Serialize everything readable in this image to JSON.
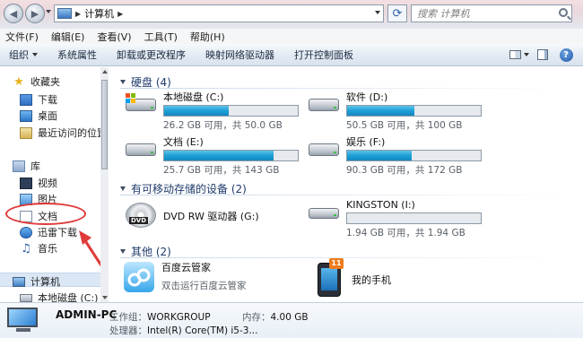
{
  "address": {
    "crumb": "计算机",
    "separator": "▶"
  },
  "search": {
    "placeholder": "搜索 计算机"
  },
  "menu": [
    "文件(F)",
    "编辑(E)",
    "查看(V)",
    "工具(T)",
    "帮助(H)"
  ],
  "toolbar": {
    "organize": "组织",
    "system_properties": "系统属性",
    "uninstall": "卸载或更改程序",
    "map_drive": "映射网络驱动器",
    "control_panel": "打开控制面板"
  },
  "nav": {
    "favorites": "收藏夹",
    "downloads": "下载",
    "desktop": "桌面",
    "recent": "最近访问的位置",
    "libraries": "库",
    "videos": "视频",
    "pictures": "图片",
    "documents": "文档",
    "thunder": "迅雷下载",
    "music": "音乐",
    "computer": "计算机",
    "local_disk": "本地磁盘 (C:)"
  },
  "groups": {
    "hdd": "硬盘 (4)",
    "removable": "有可移动存储的设备 (2)",
    "other": "其他 (2)"
  },
  "drives": {
    "c": {
      "name": "本地磁盘 (C:)",
      "cap": "26.2 GB 可用，共 50.0 GB",
      "used_fraction": 0.48
    },
    "d": {
      "name": "软件 (D:)",
      "cap": "50.5 GB 可用，共 100 GB",
      "used_fraction": 0.5
    },
    "e": {
      "name": "文档 (E:)",
      "cap": "25.7 GB 可用，共 143 GB",
      "used_fraction": 0.82
    },
    "f": {
      "name": "娱乐 (F:)",
      "cap": "90.3 GB 可用，共 172 GB",
      "used_fraction": 0.48
    },
    "g": {
      "name": "DVD RW 驱动器 (G:)"
    },
    "i": {
      "name": "KINGSTON (I:)",
      "cap": "1.94 GB 可用，共 1.94 GB",
      "used_fraction": 0.0
    }
  },
  "other": {
    "baidu": {
      "name": "百度云管家",
      "sub": "双击运行百度云管家"
    },
    "phone": {
      "name": "我的手机",
      "badge": "11"
    }
  },
  "details": {
    "pc_name": "ADMIN-PC",
    "workgroup_label": "工作组：",
    "workgroup": "WORKGROUP",
    "memory_label": "内存：",
    "memory": "4.00 GB",
    "cpu_label": "处理器：",
    "cpu": "Intel(R) Core(TM) i5-3..."
  },
  "colors": {
    "accent": "#1d9fd6",
    "annotation": "#e03a3a"
  }
}
